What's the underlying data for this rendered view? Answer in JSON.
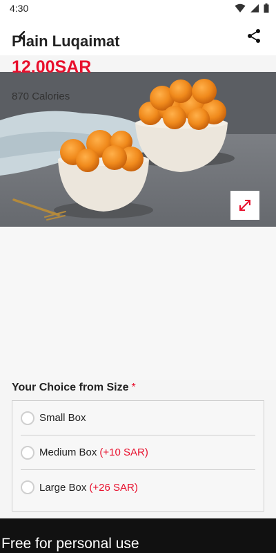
{
  "status": {
    "time": "4:30"
  },
  "product": {
    "name": "Plain Luqaimat",
    "price": "12.00SAR",
    "calories": "870 Calories"
  },
  "choice": {
    "title": "Your Choice from Size",
    "required_mark": "*",
    "options": [
      {
        "label": "Small Box",
        "extra": ""
      },
      {
        "label": "Medium Box",
        "extra": "(+10 SAR)"
      },
      {
        "label": "Large Box",
        "extra": "(+26 SAR)"
      }
    ]
  },
  "banner": {
    "text": "Free for personal use"
  },
  "colors": {
    "accent": "#e8102d",
    "border": "#cfcfcf"
  },
  "icons": {
    "back": "back-arrow-icon",
    "share": "share-icon",
    "expand": "expand-icon"
  }
}
